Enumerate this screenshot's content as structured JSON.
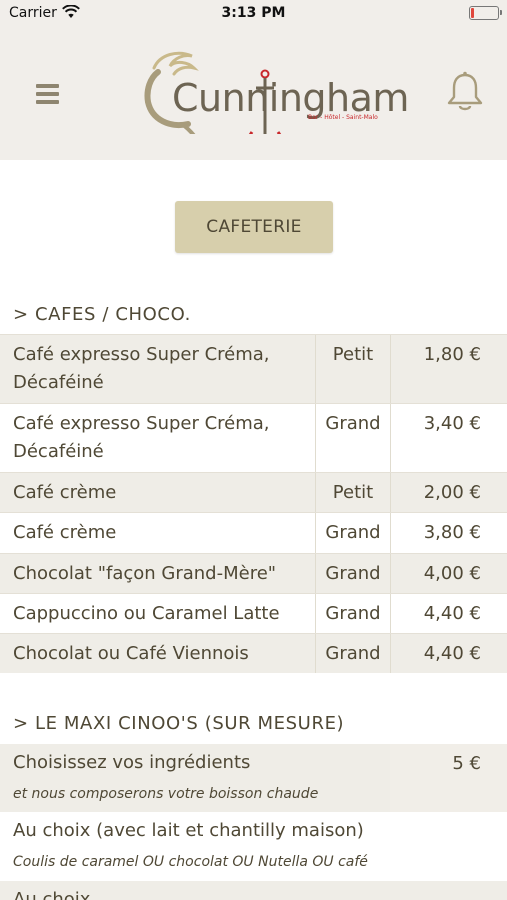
{
  "status_bar": {
    "carrier": "Carrier",
    "time": "3:13 PM"
  },
  "header": {
    "logo_text": "Cunningham",
    "logo_subtitle": "Bar - Hôtel - Saint-Malo",
    "menu_icon": "hamburger-menu-icon",
    "bell_icon": "bell-icon"
  },
  "category": {
    "label": "CAFETERIE"
  },
  "sections": [
    {
      "title": "> CAFES / CHOCO.",
      "items": [
        {
          "name_line1": "Café expresso Super Créma,",
          "name_line2": "Décaféiné",
          "size": "Petit",
          "price": "1,80 €"
        },
        {
          "name_line1": "Café expresso Super Créma,",
          "name_line2": "Décaféiné",
          "size": "Grand",
          "price": "3,40 €"
        },
        {
          "name_line1": "Café crème",
          "size": "Petit",
          "price": "2,00 €"
        },
        {
          "name_line1": "Café crème",
          "size": "Grand",
          "price": "3,80 €"
        },
        {
          "name_line1": "Chocolat \"façon Grand-Mère\"",
          "size": "Grand",
          "price": "4,00 €"
        },
        {
          "name_line1": "Cappuccino ou Caramel Latte",
          "size": "Grand",
          "price": "4,40 €"
        },
        {
          "name_line1": "Chocolat ou Café Viennois",
          "size": "Grand",
          "price": "4,40 €"
        }
      ]
    },
    {
      "title": "> LE MAXI CINOO'S (SUR MESURE)",
      "items": [
        {
          "name": "Choisissez vos ingrédients",
          "desc": "et nous composerons votre boisson chaude",
          "price": "5 €"
        },
        {
          "name": "Au choix (avec lait et chantilly maison)",
          "desc": "Coulis de caramel OU chocolat OU Nutella OU café",
          "price": ""
        },
        {
          "name": "Au choix",
          "desc": "",
          "price": ""
        }
      ]
    }
  ],
  "colors": {
    "header_bg": "#f1eeea",
    "button_bg": "#d7cfac",
    "row_shade": "#efede7",
    "text": "#4f4835",
    "logo_accent_red": "#c8282c"
  }
}
